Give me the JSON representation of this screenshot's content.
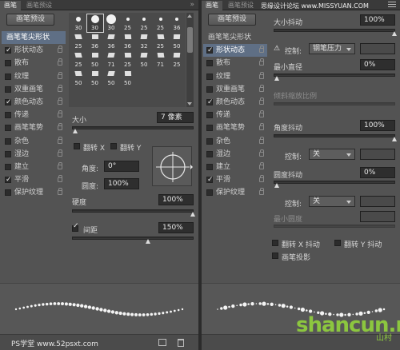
{
  "left": {
    "tabs": [
      "画笔",
      "画笔预设"
    ],
    "preset_button": "画笔预设",
    "list": [
      {
        "label": "画笔笔尖形状",
        "head": true,
        "selected": true
      },
      {
        "label": "形状动态",
        "checked": true
      },
      {
        "label": "散布",
        "checked": false
      },
      {
        "label": "纹理",
        "checked": false
      },
      {
        "label": "双重画笔",
        "checked": false
      },
      {
        "label": "颜色动态",
        "checked": true
      },
      {
        "label": "传递",
        "checked": false
      },
      {
        "label": "画笔笔势",
        "checked": false
      },
      {
        "label": "杂色",
        "checked": false
      },
      {
        "label": "湿边",
        "checked": false
      },
      {
        "label": "建立",
        "checked": false
      },
      {
        "label": "平滑",
        "checked": true
      },
      {
        "label": "保护纹理",
        "checked": false
      }
    ],
    "brush_sizes": [
      "30",
      "30",
      "30",
      "25",
      "25",
      "25",
      "36",
      "25",
      "36",
      "36",
      "36",
      "32",
      "25",
      "50",
      "25",
      "50",
      "71",
      "25",
      "50",
      "71",
      "25",
      "50",
      "50",
      "50",
      "50"
    ],
    "size_label": "大小",
    "size_value": "7 像素",
    "flip_x": "翻转 X",
    "flip_y": "翻转 Y",
    "angle_label": "角度:",
    "angle_value": "0°",
    "roundness_label": "圆度:",
    "roundness_value": "100%",
    "hardness_label": "硬度",
    "hardness_value": "100%",
    "spacing_label": "间距",
    "spacing_value": "150%",
    "spacing_checked": true,
    "watermark": "PS学堂 www.52psxt.com"
  },
  "right": {
    "tabs": [
      "画笔",
      "画笔预设"
    ],
    "preset_button": "画笔预设",
    "corner_text": "思缘设计论坛 www.MISSYUAN.COM",
    "list": [
      {
        "label": "画笔笔尖形状",
        "head": true,
        "selected": false
      },
      {
        "label": "形状动态",
        "checked": true,
        "selected": true
      },
      {
        "label": "散布",
        "checked": false
      },
      {
        "label": "纹理",
        "checked": false
      },
      {
        "label": "双重画笔",
        "checked": false
      },
      {
        "label": "颜色动态",
        "checked": true
      },
      {
        "label": "传递",
        "checked": false
      },
      {
        "label": "画笔笔势",
        "checked": false
      },
      {
        "label": "杂色",
        "checked": false
      },
      {
        "label": "湿边",
        "checked": false
      },
      {
        "label": "建立",
        "checked": false
      },
      {
        "label": "平滑",
        "checked": true
      },
      {
        "label": "保护纹理",
        "checked": false
      }
    ],
    "size_jitter_label": "大小抖动",
    "size_jitter_value": "100%",
    "control_label": "控制:",
    "control_value_1": "钢笔压力",
    "min_diameter_label": "最小直径",
    "min_diameter_value": "0%",
    "tilt_scale_label": "倾斜缩放比例",
    "angle_jitter_label": "角度抖动",
    "angle_jitter_value": "100%",
    "control_value_2": "关",
    "roundness_jitter_label": "圆度抖动",
    "roundness_jitter_value": "0%",
    "control_value_3": "关",
    "min_roundness_label": "最小圆度",
    "flip_x_jitter": "翻转 X 抖动",
    "flip_y_jitter": "翻转 Y 抖动",
    "brush_projection": "画笔投影",
    "watermark": "shancun.net",
    "watermark_cn": "山村"
  },
  "colors": {
    "panel": "#535353",
    "selected_row": "#5f6f85",
    "watermark_green": "#8cc63f"
  }
}
